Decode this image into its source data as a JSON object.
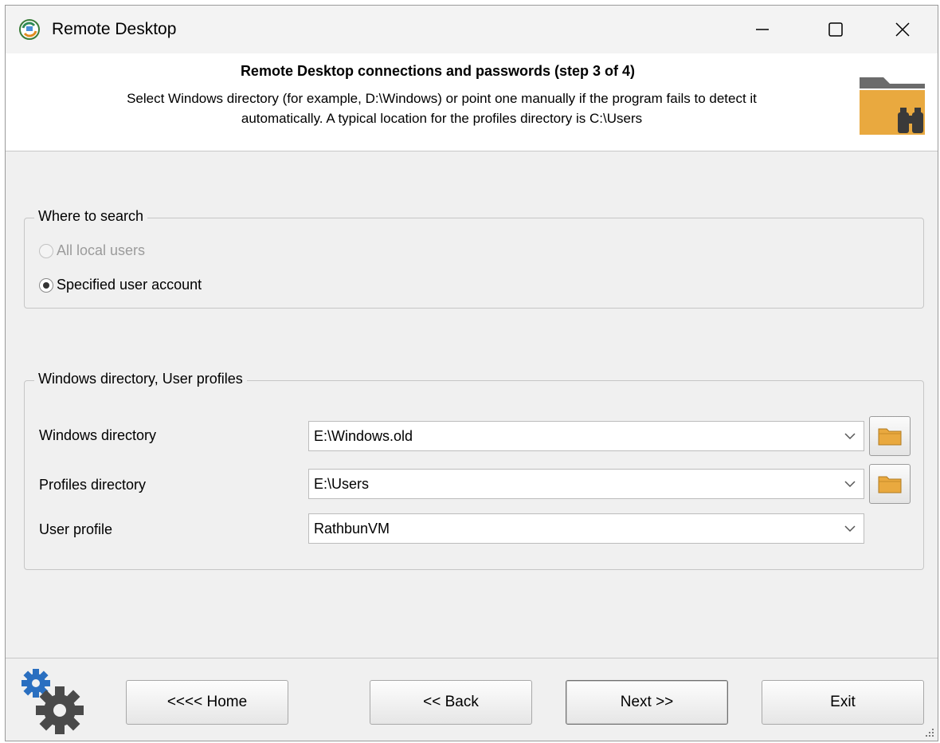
{
  "window": {
    "title": "Remote Desktop"
  },
  "header": {
    "title": "Remote Desktop connections and passwords (step 3 of 4)",
    "description_line1": "Select Windows directory (for example, D:\\Windows) or point one manually if the program fails to detect it",
    "description_line2": "automatically. A typical location for the profiles directory is C:\\Users",
    "icon": "folder-binoculars-icon"
  },
  "where_to_search": {
    "legend": "Where to search",
    "options": [
      {
        "label": "All local users",
        "checked": false,
        "enabled": false
      },
      {
        "label": "Specified user account",
        "checked": true,
        "enabled": true
      }
    ]
  },
  "directories": {
    "legend": "Windows directory, User profiles",
    "fields": [
      {
        "label": "Windows directory",
        "value": "E:\\Windows.old",
        "has_browse": true
      },
      {
        "label": "Profiles directory",
        "value": "E:\\Users",
        "has_browse": true
      },
      {
        "label": "User profile",
        "value": "RathbunVM",
        "has_browse": false
      }
    ]
  },
  "footer": {
    "buttons": {
      "home": "<<<< Home",
      "back": "<< Back",
      "next": "Next >>",
      "exit": "Exit"
    }
  },
  "colors": {
    "folder": "#e9a93f",
    "gear": "#4a4a4a",
    "gear_accent": "#2a6fc0"
  }
}
